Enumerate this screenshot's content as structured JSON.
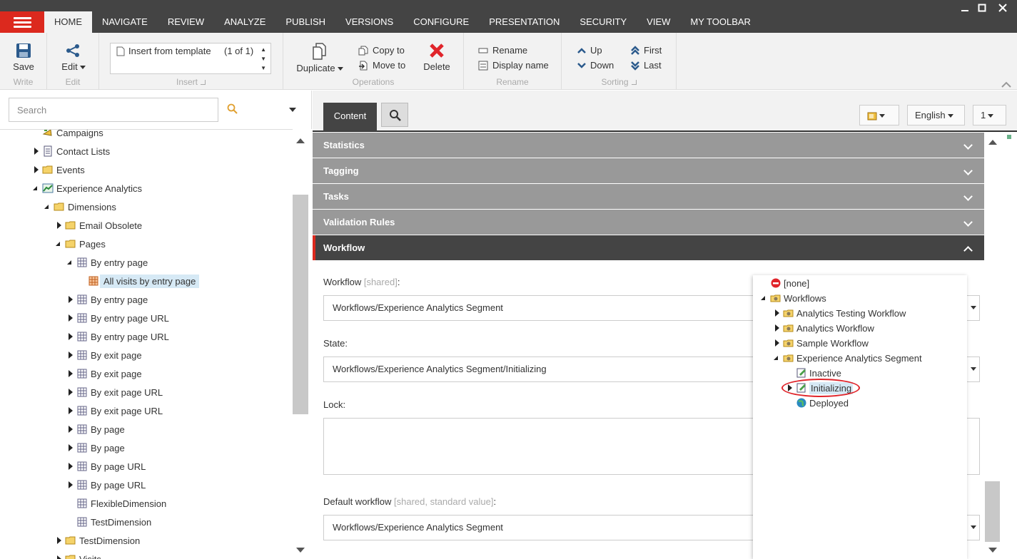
{
  "nav": {
    "tabs": [
      "HOME",
      "NAVIGATE",
      "REVIEW",
      "ANALYZE",
      "PUBLISH",
      "VERSIONS",
      "CONFIGURE",
      "PRESENTATION",
      "SECURITY",
      "VIEW",
      "MY TOOLBAR"
    ],
    "active_tab": "HOME"
  },
  "ribbon": {
    "write": {
      "save": "Save",
      "label": "Write"
    },
    "edit": {
      "edit": "Edit",
      "label": "Edit"
    },
    "insert": {
      "item": "Insert from template",
      "count": "(1 of 1)",
      "label": "Insert"
    },
    "operations": {
      "duplicate": "Duplicate",
      "copy_to": "Copy to",
      "move_to": "Move to",
      "delete": "Delete",
      "label": "Operations"
    },
    "rename": {
      "rename": "Rename",
      "display_name": "Display name",
      "label": "Rename"
    },
    "sorting": {
      "up": "Up",
      "down": "Down",
      "first": "First",
      "last": "Last",
      "label": "Sorting"
    }
  },
  "left": {
    "search_placeholder": "Search",
    "tree": [
      {
        "label": "Campaigns",
        "level": 1,
        "expander": "none",
        "icon": "campaign-icon"
      },
      {
        "label": "Contact Lists",
        "level": 1,
        "expander": "closed",
        "icon": "list-icon"
      },
      {
        "label": "Events",
        "level": 1,
        "expander": "closed",
        "icon": "folder-icon"
      },
      {
        "label": "Experience Analytics",
        "level": 1,
        "expander": "open",
        "icon": "analytics-icon"
      },
      {
        "label": "Dimensions",
        "level": 2,
        "expander": "open",
        "icon": "folder-icon"
      },
      {
        "label": "Email Obsolete",
        "level": 3,
        "expander": "closed",
        "icon": "folder-icon"
      },
      {
        "label": "Pages",
        "level": 3,
        "expander": "open",
        "icon": "folder-icon"
      },
      {
        "label": "By entry page",
        "level": 4,
        "expander": "open",
        "icon": "grid-icon"
      },
      {
        "label": "All visits by entry page",
        "level": 5,
        "expander": "none",
        "icon": "segment-icon",
        "selected": true
      },
      {
        "label": "By entry page",
        "level": 4,
        "expander": "closed",
        "icon": "grid-icon"
      },
      {
        "label": "By entry page URL",
        "level": 4,
        "expander": "closed",
        "icon": "grid-icon"
      },
      {
        "label": "By entry page URL",
        "level": 4,
        "expander": "closed",
        "icon": "grid-icon"
      },
      {
        "label": "By exit page",
        "level": 4,
        "expander": "closed",
        "icon": "grid-icon"
      },
      {
        "label": "By exit page",
        "level": 4,
        "expander": "closed",
        "icon": "grid-icon"
      },
      {
        "label": "By exit page URL",
        "level": 4,
        "expander": "closed",
        "icon": "grid-icon"
      },
      {
        "label": "By exit page URL",
        "level": 4,
        "expander": "closed",
        "icon": "grid-icon"
      },
      {
        "label": "By page",
        "level": 4,
        "expander": "closed",
        "icon": "grid-icon"
      },
      {
        "label": "By page",
        "level": 4,
        "expander": "closed",
        "icon": "grid-icon"
      },
      {
        "label": "By page URL",
        "level": 4,
        "expander": "closed",
        "icon": "grid-icon"
      },
      {
        "label": "By page URL",
        "level": 4,
        "expander": "closed",
        "icon": "grid-icon"
      },
      {
        "label": "FlexibleDimension",
        "level": 4,
        "expander": "none",
        "icon": "grid-icon"
      },
      {
        "label": "TestDimension",
        "level": 4,
        "expander": "none",
        "icon": "grid-icon"
      },
      {
        "label": "TestDimension",
        "level": 3,
        "expander": "closed",
        "icon": "folder-icon"
      },
      {
        "label": "Visits",
        "level": 3,
        "expander": "closed",
        "icon": "folder-icon"
      }
    ]
  },
  "content": {
    "tab": "Content",
    "language": "English",
    "version": "1",
    "sections": [
      "Statistics",
      "Tagging",
      "Tasks",
      "Validation Rules",
      "Workflow"
    ],
    "active_section": "Workflow",
    "fields": {
      "workflow": {
        "label": "Workflow",
        "hint": "[shared]",
        "colon": ":",
        "value": "Workflows/Experience Analytics Segment"
      },
      "state": {
        "label": "State:",
        "value": "Workflows/Experience Analytics Segment/Initializing"
      },
      "lock": {
        "label": "Lock:"
      },
      "default_workflow": {
        "label": "Default workflow",
        "hint": "[shared, standard value]",
        "colon": ":",
        "value": "Workflows/Experience Analytics Segment"
      }
    }
  },
  "popup": {
    "items": [
      {
        "label": "[none]",
        "level": 0,
        "expander": "none",
        "icon": "no-entry-icon"
      },
      {
        "label": "Workflows",
        "level": 0,
        "expander": "open",
        "icon": "workflow-folder-icon"
      },
      {
        "label": "Analytics Testing Workflow",
        "level": 1,
        "expander": "closed",
        "icon": "workflow-folder-icon"
      },
      {
        "label": "Analytics Workflow",
        "level": 1,
        "expander": "closed",
        "icon": "workflow-folder-icon"
      },
      {
        "label": "Sample Workflow",
        "level": 1,
        "expander": "closed",
        "icon": "workflow-folder-icon"
      },
      {
        "label": "Experience Analytics Segment",
        "level": 1,
        "expander": "open",
        "icon": "workflow-folder-icon"
      },
      {
        "label": "Inactive",
        "level": 2,
        "expander": "none",
        "icon": "state-icon"
      },
      {
        "label": "Initializing",
        "level": 2,
        "expander": "closed",
        "icon": "state-icon",
        "highlighted": true
      },
      {
        "label": "Deployed",
        "level": 2,
        "expander": "none",
        "icon": "globe-icon"
      }
    ]
  },
  "colors": {
    "accent": "#dc291e",
    "topbar": "#444444",
    "section": "#999999",
    "highlight": "#d6e9f5"
  }
}
